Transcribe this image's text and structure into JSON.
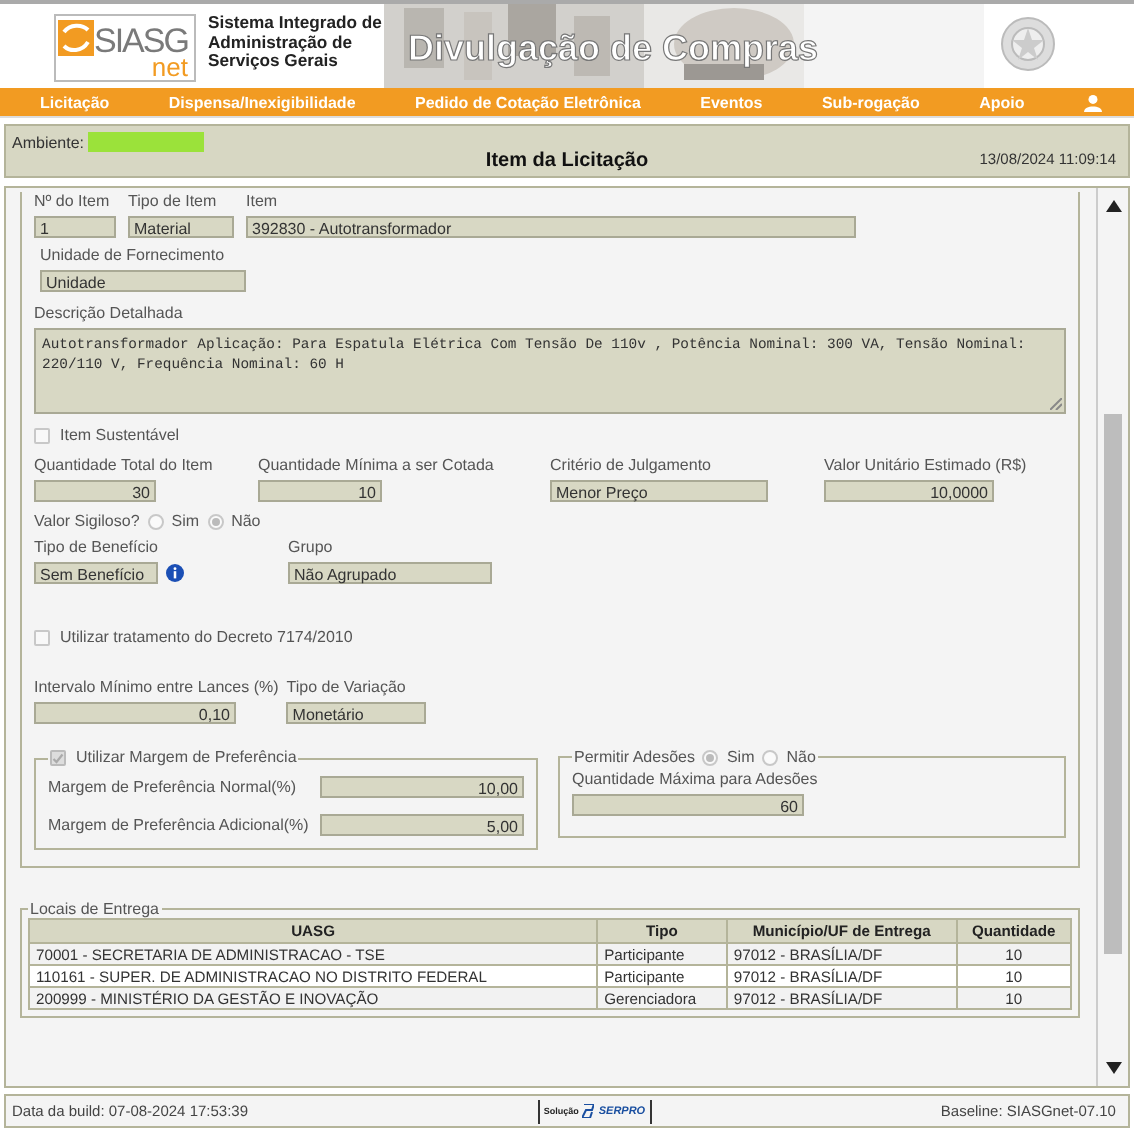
{
  "header": {
    "logo_text": "SIASG",
    "logo_sub": "net",
    "system_name": "Sistema Integrado de Administração de Serviços Gerais",
    "banner_title": "Divulgação de Compras"
  },
  "nav": [
    {
      "label": "Licitação"
    },
    {
      "label": "Dispensa/Inexigibilidade"
    },
    {
      "label": "Pedido de Cotação Eletrônica"
    },
    {
      "label": "Eventos"
    },
    {
      "label": "Sub-rogação"
    },
    {
      "label": "Apoio"
    }
  ],
  "title_bar": {
    "environment_label": "Ambiente:",
    "title": "Item da Licitação",
    "datetime": "13/08/2024 11:09:14"
  },
  "item": {
    "number": {
      "label": "Nº do Item",
      "value": "1"
    },
    "type": {
      "label": "Tipo de Item",
      "value": "Material"
    },
    "item": {
      "label": "Item",
      "value": "392830 - Autotransformador"
    },
    "unit": {
      "label": "Unidade de Fornecimento",
      "value": "Unidade"
    },
    "description": {
      "label": "Descrição Detalhada",
      "value": "Autotransformador Aplicação: Para Espatula Elétrica Com Tensão De 110v , Potência Nominal: 300 VA, Tensão Nominal: 220/110 V, Frequência Nominal: 60 H"
    },
    "sustainable": {
      "label": "Item Sustentável",
      "checked": false
    },
    "total_quantity": {
      "label": "Quantidade Total do Item",
      "value": "30"
    },
    "min_quantity": {
      "label": "Quantidade Mínima a ser Cotada",
      "value": "10"
    },
    "criterion": {
      "label": "Critério de Julgamento",
      "value": "Menor Preço"
    },
    "unit_value": {
      "label": "Valor Unitário Estimado (R$)",
      "value": "10,0000"
    },
    "secret_value": {
      "label": "Valor Sigiloso?",
      "options": [
        {
          "label": "Sim",
          "selected": false
        },
        {
          "label": "Não",
          "selected": true
        }
      ]
    },
    "benefit": {
      "label": "Tipo de Benefício",
      "value": "Sem Benefício"
    },
    "group": {
      "label": "Grupo",
      "value": "Não Agrupado"
    },
    "decree": {
      "label": "Utilizar tratamento do Decreto 7174/2010",
      "checked": false
    },
    "bid_interval": {
      "label": "Intervalo Mínimo entre Lances (%)",
      "value": "0,10"
    },
    "variation_type": {
      "label": "Tipo de Variação",
      "value": "Monetário"
    },
    "preference_margin": {
      "label": "Utilizar Margem de Preferência",
      "checked": true,
      "normal_label": "Margem de Preferência Normal(%)",
      "normal_value": "10,00",
      "additional_label": "Margem de Preferência Adicional(%)",
      "additional_value": "5,00"
    },
    "adhesions": {
      "label": "Permitir Adesões",
      "options": [
        {
          "label": "Sim",
          "selected": true
        },
        {
          "label": "Não",
          "selected": false
        }
      ],
      "max_label": "Quantidade Máxima para Adesões",
      "max_value": "60"
    }
  },
  "delivery": {
    "legend": "Locais de Entrega",
    "columns": [
      "UASG",
      "Tipo",
      "Município/UF de Entrega",
      "Quantidade"
    ],
    "rows": [
      [
        "70001 - SECRETARIA DE ADMINISTRACAO - TSE",
        "Participante",
        "97012 - BRASÍLIA/DF",
        "10"
      ],
      [
        "110161 - SUPER. DE ADMINISTRACAO NO DISTRITO FEDERAL",
        "Participante",
        "97012 - BRASÍLIA/DF",
        "10"
      ],
      [
        "200999 - MINISTÉRIO DA GESTÃO E INOVAÇÃO",
        "Gerenciadora",
        "97012 - BRASÍLIA/DF",
        "10"
      ]
    ]
  },
  "footer": {
    "build": "Data da build: 07-08-2024 17:53:39",
    "vendor_small": "Solução",
    "vendor": "SERPRO",
    "baseline": "Baseline: SIASGnet-07.10"
  }
}
